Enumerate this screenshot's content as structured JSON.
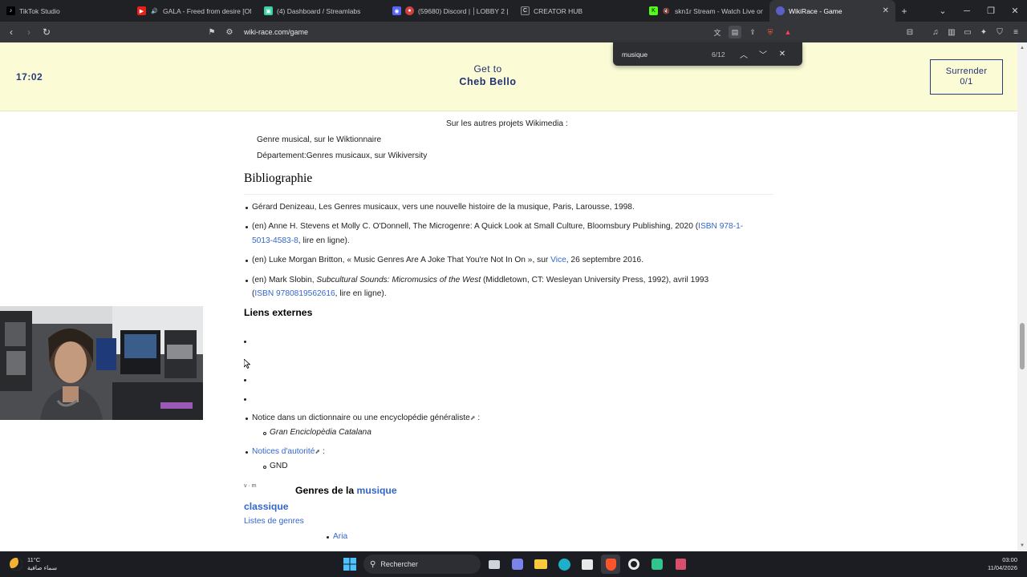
{
  "browser": {
    "tabs": [
      {
        "label": "TikTok Studio",
        "favicon": "tiktok-icon",
        "active": false
      },
      {
        "label": "GALA - Freed from desire [Offic",
        "favicon": "youtube-icon",
        "active": false
      },
      {
        "label": "(4) Dashboard / Streamlabs",
        "favicon": "streamlabs-icon",
        "active": false
      },
      {
        "label": "(59680) Discord | │LOBBY 2 | │",
        "favicon": "discord-icon",
        "active": false
      },
      {
        "label": "CREATOR HUB",
        "favicon": "creatorhub-icon",
        "active": false
      },
      {
        "label": "skn1r Stream - Watch Live on Ki",
        "favicon": "kick-icon",
        "active": false
      },
      {
        "label": "WikiRace - Game",
        "favicon": "wikirace-icon",
        "active": true
      }
    ],
    "url": "wiki-race.com/game"
  },
  "game": {
    "timer": "17:02",
    "get_to_label": "Get to",
    "target": "Cheb Bello",
    "surrender_label": "Surrender",
    "surrender_count": "0/1"
  },
  "find": {
    "query": "musique",
    "count": "6/12"
  },
  "article": {
    "sister_header": "Sur les autres projets Wikimedia :",
    "sister_items": [
      "Genre musical, sur le Wiktionnaire",
      "Département:Genres musicaux, sur Wikiversity"
    ],
    "biblio_heading": "Bibliographie",
    "biblio": {
      "b1": "Gérard Denizeau, Les Genres musicaux, vers une nouvelle histoire de la musique, Paris, Larousse, 1998.",
      "b2_pre": "(en) Anne H. Stevens et Molly C. O'Donnell, The Microgenre: A Quick Look at Small Culture, Bloomsbury Publishing, 2020 (",
      "b2_link": "ISBN 978-1-",
      "b2_link2": "5013-4583-8",
      "b2_post": ", lire en ligne).",
      "b3_pre": "(en) Luke Morgan Britton, « Music Genres Are A Joke That You're Not In On », sur ",
      "b3_link": "Vice",
      "b3_post": ", 26 septembre 2016.",
      "b4_pre": "(en) Mark Slobin, ",
      "b4_italic": "Subcultural Sounds: Micromusics of the West",
      "b4_post": " (Middletown, CT: Wesleyan University Press, 1992), avril 1993",
      "b4_open": "(",
      "b4_link": "ISBN 9780819562616",
      "b4_end": ", lire en ligne)."
    },
    "external_heading": "Liens externes",
    "notice_dict": "Notice dans un dictionnaire ou une encyclopédie généraliste",
    "notice_colon": " :",
    "notice_dict_item": "Gran Enciclopèdia Catalana",
    "authority_link": "Notices d'autorité",
    "authority_colon": " :",
    "authority_item": "GND",
    "navbox_title_pre": "Genres de la ",
    "navbox_title_link": "musique",
    "navbox_section": "classique",
    "navbox_list_link": "Listes de genres",
    "navbox_item": "Aria"
  },
  "taskbar": {
    "temperature": "11°C",
    "weather_desc": "سماء صافية",
    "search_label": "Rechercher",
    "time": "03:00",
    "date": "11/04/2026"
  },
  "colors": {
    "game_header_bg": "#fbfcd6",
    "game_text": "#223070",
    "link": "#3366cc",
    "browser_chrome": "#202124"
  }
}
